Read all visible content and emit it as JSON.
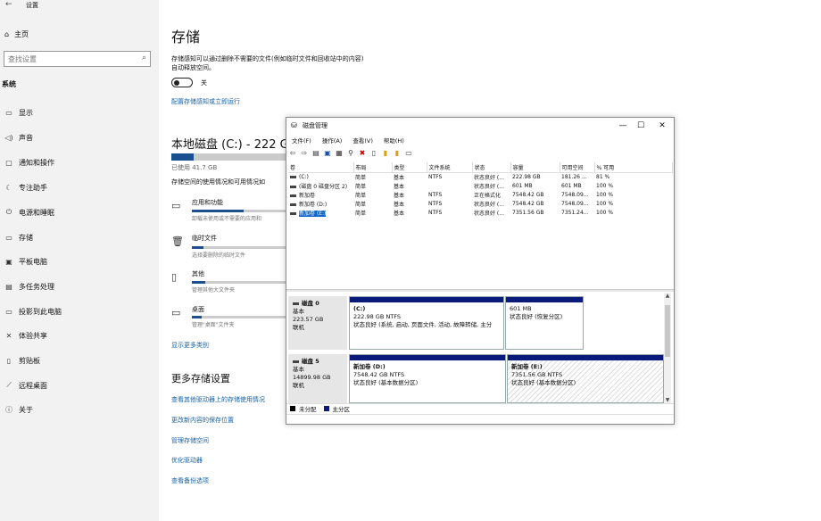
{
  "settings": {
    "app_title": "设置",
    "home": "主页",
    "search_placeholder": "查找设置",
    "section": "系统",
    "nav": [
      {
        "label": "显示",
        "icon": "display-icon"
      },
      {
        "label": "声音",
        "icon": "sound-icon"
      },
      {
        "label": "通知和操作",
        "icon": "notification-icon"
      },
      {
        "label": "专注助手",
        "icon": "focus-assist-icon"
      },
      {
        "label": "电源和睡眠",
        "icon": "power-icon"
      },
      {
        "label": "存储",
        "icon": "storage-icon"
      },
      {
        "label": "平板电脑",
        "icon": "tablet-icon"
      },
      {
        "label": "多任务处理",
        "icon": "multitask-icon"
      },
      {
        "label": "投影到此电脑",
        "icon": "project-icon"
      },
      {
        "label": "体验共享",
        "icon": "shared-experience-icon"
      },
      {
        "label": "剪贴板",
        "icon": "clipboard-icon"
      },
      {
        "label": "远程桌面",
        "icon": "remote-desktop-icon"
      },
      {
        "label": "关于",
        "icon": "info-icon"
      }
    ]
  },
  "storage": {
    "title": "存储",
    "desc_line1": "存储感知可以通过删除不需要的文件(例如临时文件和回收站中的内容)",
    "desc_line2": "自动释放空间。",
    "toggle_state": "关",
    "configure_link": "配置存储感知或立即运行",
    "local_disk_title": "本地磁盘 (C:) - 222 G",
    "used_label": "已使用 41.7 GB",
    "used_fraction": 0.19,
    "usage_desc": "存储空间的使用情况和可用情况如",
    "categories": [
      {
        "title": "应用和功能",
        "sub": "卸载未使用或不需要的应用和",
        "fill": 0.55,
        "icon": "apps-icon"
      },
      {
        "title": "临时文件",
        "sub": "选择要删除的临时文件",
        "fill": 0.12,
        "icon": "trash-icon"
      },
      {
        "title": "其他",
        "sub": "管理其他大文件夹",
        "fill": 0.14,
        "icon": "folder-icon"
      },
      {
        "title": "桌面",
        "sub": "管理\"桌面\"文件夹",
        "fill": 0.1,
        "icon": "desktop-icon"
      }
    ],
    "show_more": "显示更多类别",
    "more_title": "更多存储设置",
    "more_links": [
      "查看其他驱动器上的存储使用情况",
      "更改新内容的保存位置",
      "管理存储空间",
      "优化驱动器",
      "查看备份选项"
    ]
  },
  "disk_mgmt": {
    "title": "磁盘管理",
    "menu": [
      "文件(F)",
      "操作(A)",
      "查看(V)",
      "帮助(H)"
    ],
    "columns": [
      "卷",
      "布局",
      "类型",
      "文件系统",
      "状态",
      "容量",
      "可用空间",
      "% 可用"
    ],
    "rows": [
      [
        "(C:)",
        "简单",
        "基本",
        "NTFS",
        "状态良好 (...",
        "222.98 GB",
        "181.26 ...",
        "81 %"
      ],
      [
        "(磁盘 0 磁盘分区 2)",
        "简单",
        "基本",
        "",
        "状态良好 (...",
        "601 MB",
        "601 MB",
        "100 %"
      ],
      [
        "新加卷",
        "简单",
        "基本",
        "NTFS",
        "正在格式化",
        "7548.42 GB",
        "7548.09...",
        "100 %"
      ],
      [
        "新加卷 (D:)",
        "简单",
        "基本",
        "NTFS",
        "状态良好 (...",
        "7548.42 GB",
        "7548.09...",
        "100 %"
      ],
      [
        "新加卷 (E:)",
        "简单",
        "基本",
        "NTFS",
        "状态良好 (...",
        "7351.56 GB",
        "7351.24...",
        "100 %"
      ]
    ],
    "disks": [
      {
        "name": "磁盘 0",
        "type": "基本",
        "size": "223.57 GB",
        "status": "联机",
        "partitions": [
          {
            "name": "(C:)",
            "fs": "222.98 GB NTFS",
            "state": "状态良好 (系统, 启动, 页面文件, 活动, 故障转储, 主分"
          },
          {
            "name": "",
            "fs": "601 MB",
            "state": "状态良好 (恢复分区)"
          }
        ]
      },
      {
        "name": "磁盘 5",
        "type": "基本",
        "size": "14899.98 GB",
        "status": "联机",
        "partitions": [
          {
            "name": "新加卷 (D:)",
            "fs": "7548.42 GB NTFS",
            "state": "状态良好 (基本数据分区)"
          },
          {
            "name": "新加卷 (E:)",
            "fs": "7351.56 GB NTFS",
            "state": "状态良好 (基本数据分区)"
          }
        ]
      }
    ],
    "legend": [
      {
        "label": "未分配",
        "color": "#000000"
      },
      {
        "label": "主分区",
        "color": "#0a1a7a"
      }
    ]
  }
}
